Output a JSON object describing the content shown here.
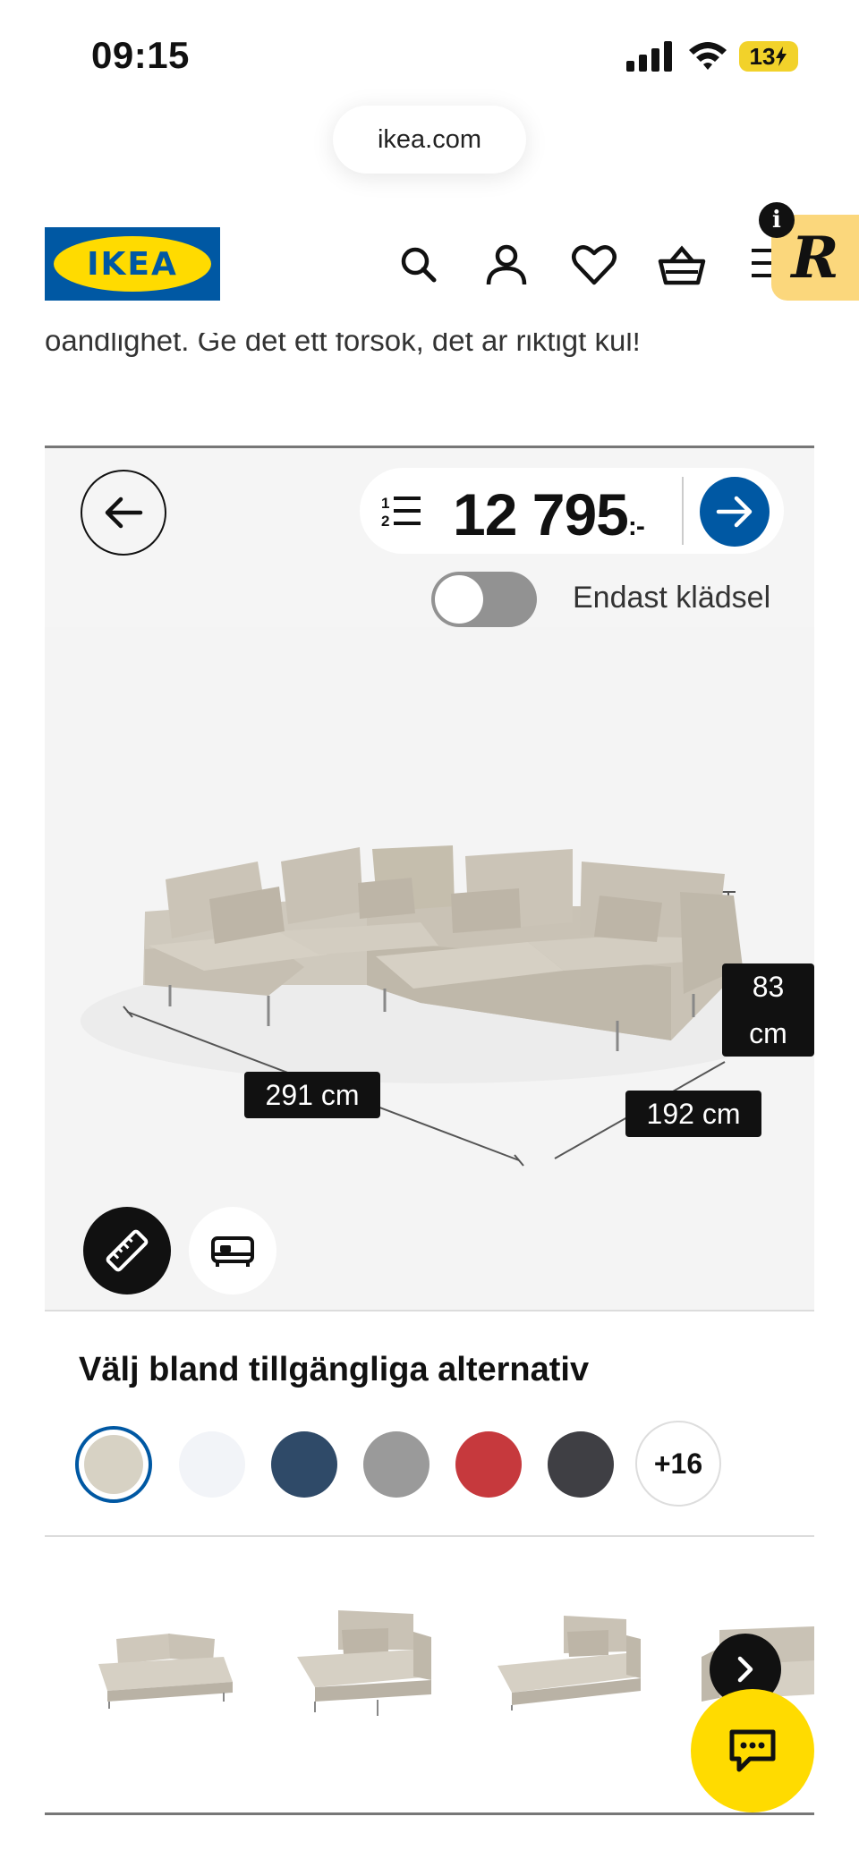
{
  "status_bar": {
    "time": "09:15",
    "battery": "13"
  },
  "browser": {
    "url": "ikea.com"
  },
  "header": {
    "logo_text": "IKEA"
  },
  "r_badge": {
    "letter": "R",
    "info": "i"
  },
  "intro": {
    "text": "oändlighet. Ge det ett försök, det är riktigt kul!"
  },
  "configurator": {
    "price": "12 795",
    "price_suffix": ":-",
    "toggle_label": "Endast klädsel",
    "toggle_on": false,
    "dimensions": {
      "width": "291 cm",
      "depth": "192 cm",
      "height_value": "83",
      "height_unit": "cm"
    }
  },
  "options": {
    "title": "Välj bland tillgängliga alternativ",
    "swatches": [
      "#d7d2c4",
      "#f2f4f8",
      "#2f4a68",
      "#9a9a9a",
      "#c6393d",
      "#3f3f44"
    ],
    "more_label": "+16"
  }
}
